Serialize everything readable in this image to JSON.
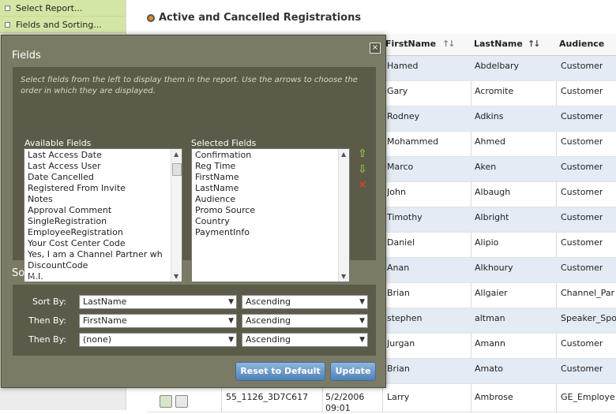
{
  "sidebar": {
    "items": [
      {
        "label": "Select Report..."
      },
      {
        "label": "Fields and Sorting..."
      }
    ]
  },
  "page": {
    "title": "Active and Cancelled Registrations"
  },
  "grid": {
    "columns": [
      {
        "label": "FirstName",
        "sortable": true
      },
      {
        "label": "LastName",
        "sortable": true
      },
      {
        "label": "Audience",
        "sortable": false
      }
    ],
    "rows": [
      {
        "first": "Hamed",
        "last": "Abdelbary",
        "audience": "Customer"
      },
      {
        "first": "Gary",
        "last": "Acromite",
        "audience": "Customer"
      },
      {
        "first": "Rodney",
        "last": "Adkins",
        "audience": "Customer"
      },
      {
        "first": "Mohammed",
        "last": "Ahmed",
        "audience": "Customer"
      },
      {
        "first": "Marco",
        "last": "Aken",
        "audience": "Customer"
      },
      {
        "first": "John",
        "last": "Albaugh",
        "audience": "Customer"
      },
      {
        "first": "Timothy",
        "last": "Albright",
        "audience": "Customer"
      },
      {
        "first": "Daniel",
        "last": "Alipio",
        "audience": "Customer"
      },
      {
        "first": "Anan",
        "last": "Alkhoury",
        "audience": "Customer"
      },
      {
        "first": "Brian",
        "last": "Allgaier",
        "audience": "Channel_Par"
      },
      {
        "first": "stephen",
        "last": "altman",
        "audience": "Speaker_Spo"
      },
      {
        "first": "Jurgan",
        "last": "Amann",
        "audience": "Customer"
      },
      {
        "first": "Brian",
        "last": "Amato",
        "audience": "Customer"
      }
    ],
    "last_row": {
      "id": "55_1126_3D7C617",
      "date": "5/2/2006",
      "time": "09:01",
      "first": "Larry",
      "last": "Ambrose",
      "audience": "GE_Employe"
    }
  },
  "modal": {
    "fields_title": "Fields",
    "instructions": "Select fields from the left to display them in the report. Use the arrows to choose the order in which they are displayed.",
    "available_label": "Available Fields",
    "selected_label": "Selected Fields",
    "available_fields": [
      "Last Access Date",
      "Last Access User",
      "Date Cancelled",
      "Registered From Invite",
      "Notes",
      "Approval Comment",
      "SingleRegistration",
      "EmployeeRegistration",
      "Your Cost Center Code",
      "Yes, I am a Channel Partner wh",
      "DiscountCode",
      "M.I."
    ],
    "selected_fields": [
      "Confirmation",
      "Reg Time",
      "FirstName",
      "LastName",
      "Audience",
      "Promo Source",
      "Country",
      "PaymentInfo"
    ],
    "sorting_title": "Sorting",
    "sort_rows": [
      {
        "label": "Sort By:",
        "field": "LastName",
        "order": "Ascending"
      },
      {
        "label": "Then By:",
        "field": "FirstName",
        "order": "Ascending"
      },
      {
        "label": "Then By:",
        "field": "(none)",
        "order": "Ascending"
      }
    ],
    "reset_label": "Reset to Default",
    "update_label": "Update",
    "close_glyph": "×",
    "up_glyph": "⇧",
    "down_glyph": "⇩",
    "remove_glyph": "✕",
    "colors": {
      "up": "#8ac640",
      "down": "#8ac640",
      "remove": "#e0431c"
    }
  }
}
